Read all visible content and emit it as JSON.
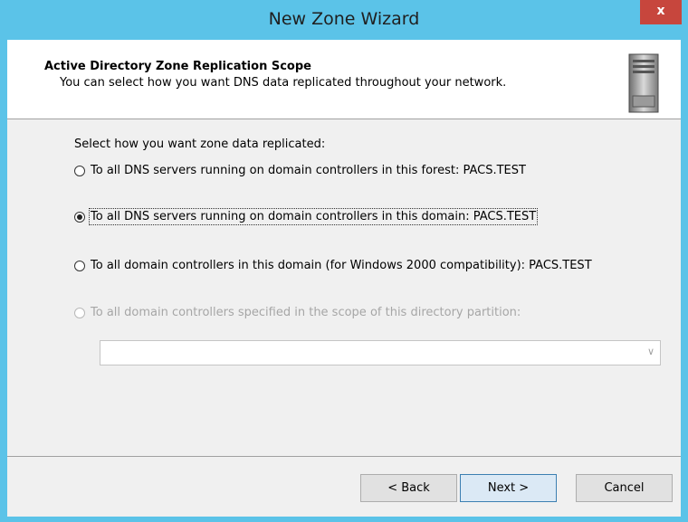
{
  "window": {
    "title": "New Zone Wizard",
    "close_label": "x"
  },
  "header": {
    "title": "Active Directory Zone Replication Scope",
    "subtitle": "You can select how you want DNS data replicated throughout your network.",
    "icon": "server-icon"
  },
  "main": {
    "prompt": "Select how you want zone data replicated:",
    "options": [
      {
        "label": "To all DNS servers running on domain controllers in this forest: PACS.TEST",
        "checked": false,
        "enabled": true
      },
      {
        "label": "To all DNS servers running on domain controllers in this domain: PACS.TEST",
        "checked": true,
        "enabled": true
      },
      {
        "label": "To all domain controllers in this domain (for Windows 2000 compatibility): PACS.TEST",
        "checked": false,
        "enabled": true
      },
      {
        "label": "To all domain controllers specified in the scope of this directory partition:",
        "checked": false,
        "enabled": false
      }
    ],
    "partition_combo": {
      "value": ""
    }
  },
  "buttons": {
    "back": "< Back",
    "next": "Next >",
    "cancel": "Cancel"
  },
  "colors": {
    "titlebar": "#5bc3e8",
    "close": "#c7463d",
    "client": "#f0f0f0"
  }
}
